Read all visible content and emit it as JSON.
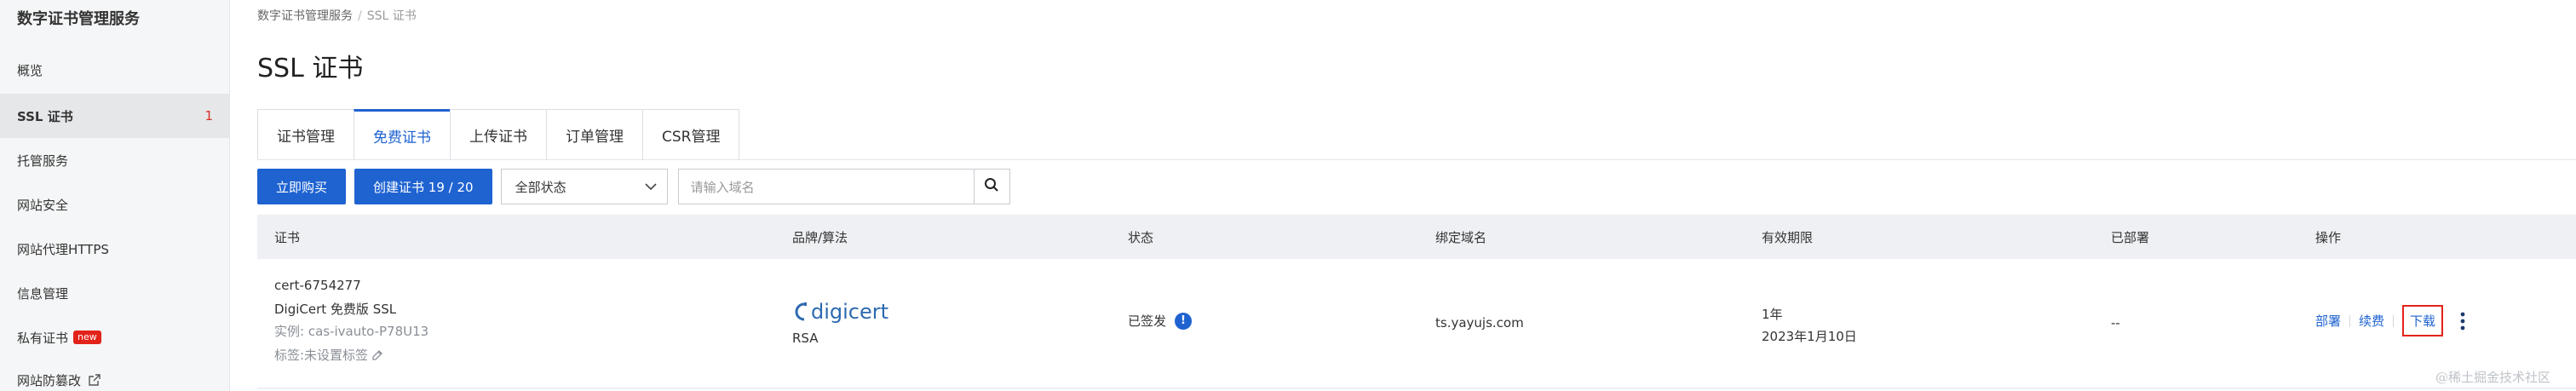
{
  "sidebar": {
    "title": "数字证书管理服务",
    "items": [
      {
        "label": "概览"
      },
      {
        "label": "SSL 证书",
        "count": "1"
      },
      {
        "label": "托管服务"
      },
      {
        "label": "网站安全"
      },
      {
        "label": "网站代理HTTPS"
      },
      {
        "label": "信息管理"
      },
      {
        "label": "私有证书",
        "badge": "new"
      },
      {
        "label": "网站防篡改"
      }
    ]
  },
  "breadcrumb": {
    "parent": "数字证书管理服务",
    "separator": "/",
    "current": "SSL 证书"
  },
  "page_title": "SSL 证书",
  "tabs": [
    {
      "label": "证书管理"
    },
    {
      "label": "免费证书"
    },
    {
      "label": "上传证书"
    },
    {
      "label": "订单管理"
    },
    {
      "label": "CSR管理"
    }
  ],
  "toolbar": {
    "buy_label": "立即购买",
    "create_label": "创建证书 19 / 20",
    "status_select": "全部状态",
    "search_placeholder": "请输入域名"
  },
  "table": {
    "headers": [
      "证书",
      "品牌/算法",
      "状态",
      "绑定域名",
      "有效期限",
      "已部署",
      "操作"
    ],
    "rows": [
      {
        "cert_id": "cert-6754277",
        "cert_name": "DigiCert 免费版 SSL",
        "instance": "实例: cas-ivauto-P78U13",
        "tag": "标签:未设置标签",
        "brand": "digicert",
        "algorithm": "RSA",
        "status": "已签发",
        "domain": "ts.yayujs.com",
        "validity_term": "1年",
        "validity_date": "2023年1月10日",
        "deployed": "--",
        "actions": {
          "deploy": "部署",
          "renew": "续费",
          "download": "下载"
        }
      }
    ]
  },
  "watermark": "@稀土掘金技术社区",
  "colors": {
    "accent": "#1f63d1",
    "alert": "#e2231a",
    "sidebar_bg": "#f5f6f7",
    "header_bg": "#eef0f3"
  }
}
